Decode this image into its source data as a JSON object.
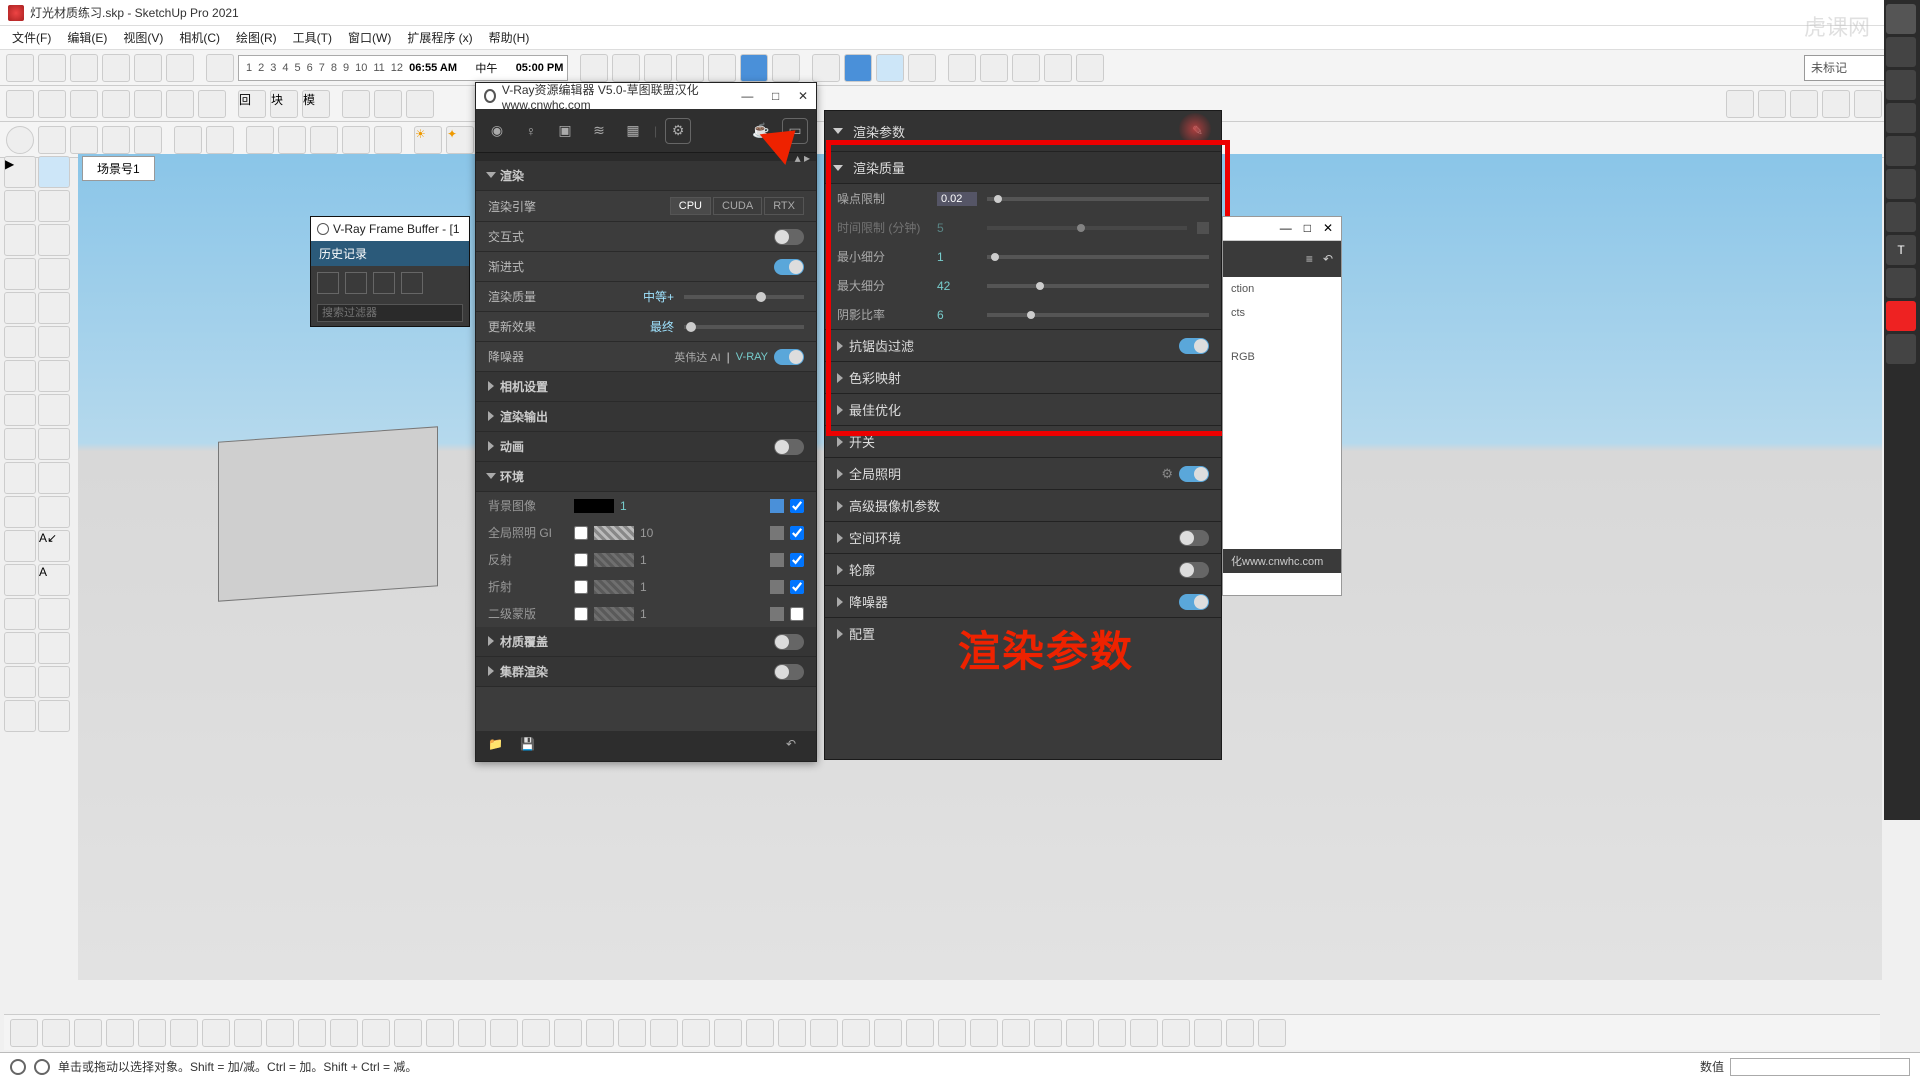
{
  "app": {
    "title": "灯光材质练习.skp - SketchUp Pro 2021"
  },
  "menu": [
    "文件(F)",
    "编辑(E)",
    "视图(V)",
    "相机(C)",
    "绘图(R)",
    "工具(T)",
    "窗口(W)",
    "扩展程序 (x)",
    "帮助(H)"
  ],
  "timebar": {
    "ticks": [
      "1",
      "2",
      "3",
      "4",
      "5",
      "6",
      "7",
      "8",
      "9",
      "10",
      "11",
      "12"
    ],
    "t1": "06:55 AM",
    "mid": "中午",
    "t2": "05:00 PM"
  },
  "tag": {
    "label": "未标记"
  },
  "scene_tab": "场景号1",
  "vray_editor": {
    "title": "V-Ray资源编辑器 V5.0-草图联盟汉化 www.cnwhc.com",
    "sections": {
      "render": "渲染",
      "engine_lbl": "渲染引擎",
      "engines": [
        "CPU",
        "CUDA",
        "RTX"
      ],
      "interactive": "交互式",
      "progressive": "渐进式",
      "quality": "渲染质量",
      "quality_val": "中等+",
      "update": "更新效果",
      "update_val": "最终",
      "denoiser": "降噪器",
      "denoiser_a": "英伟达 AI",
      "denoiser_b": "V-RAY",
      "camera": "相机设置",
      "output": "渲染输出",
      "anim": "动画",
      "env": "环境",
      "bgimg": "背景图像",
      "bgimg_v": "1",
      "gi": "全局照明 GI",
      "gi_v": "10",
      "refl": "反射",
      "refl_v": "1",
      "refr": "折射",
      "refr_v": "1",
      "matte": "二级蒙版",
      "matte_v": "1",
      "matover": "材质覆盖",
      "swarm": "集群渲染"
    }
  },
  "rparams": {
    "head": "渲染参数",
    "quality": "渲染质量",
    "noise": "噪点限制",
    "noise_v": "0.02",
    "timelimit": "时间限制 (分钟)",
    "timelimit_v": "5",
    "minsub": "最小细分",
    "minsub_v": "1",
    "maxsub": "最大细分",
    "maxsub_v": "42",
    "shade": "阴影比率",
    "shade_v": "6",
    "aa": "抗锯齿过滤",
    "color": "色彩映射",
    "opt": "最佳优化",
    "switches": "开关",
    "gi": "全局照明",
    "advcam": "高级摄像机参数",
    "env": "空间环境",
    "contour": "轮廓",
    "denoise": "降噪器",
    "config": "配置",
    "url": "化www.cnwhc.com"
  },
  "vfb": {
    "title": "V-Ray Frame Buffer - [1",
    "history": "历史记录",
    "search_ph": "搜索过滤器"
  },
  "peek": {
    "r1": "ction",
    "r2": "cts",
    "r3": "RGB"
  },
  "annot": "渲染参数",
  "status": {
    "hint": "单击或拖动以选择对象。Shift = 加/减。Ctrl = 加。Shift + Ctrl = 减。",
    "val_lbl": "数值"
  },
  "watermark": "虎课网"
}
